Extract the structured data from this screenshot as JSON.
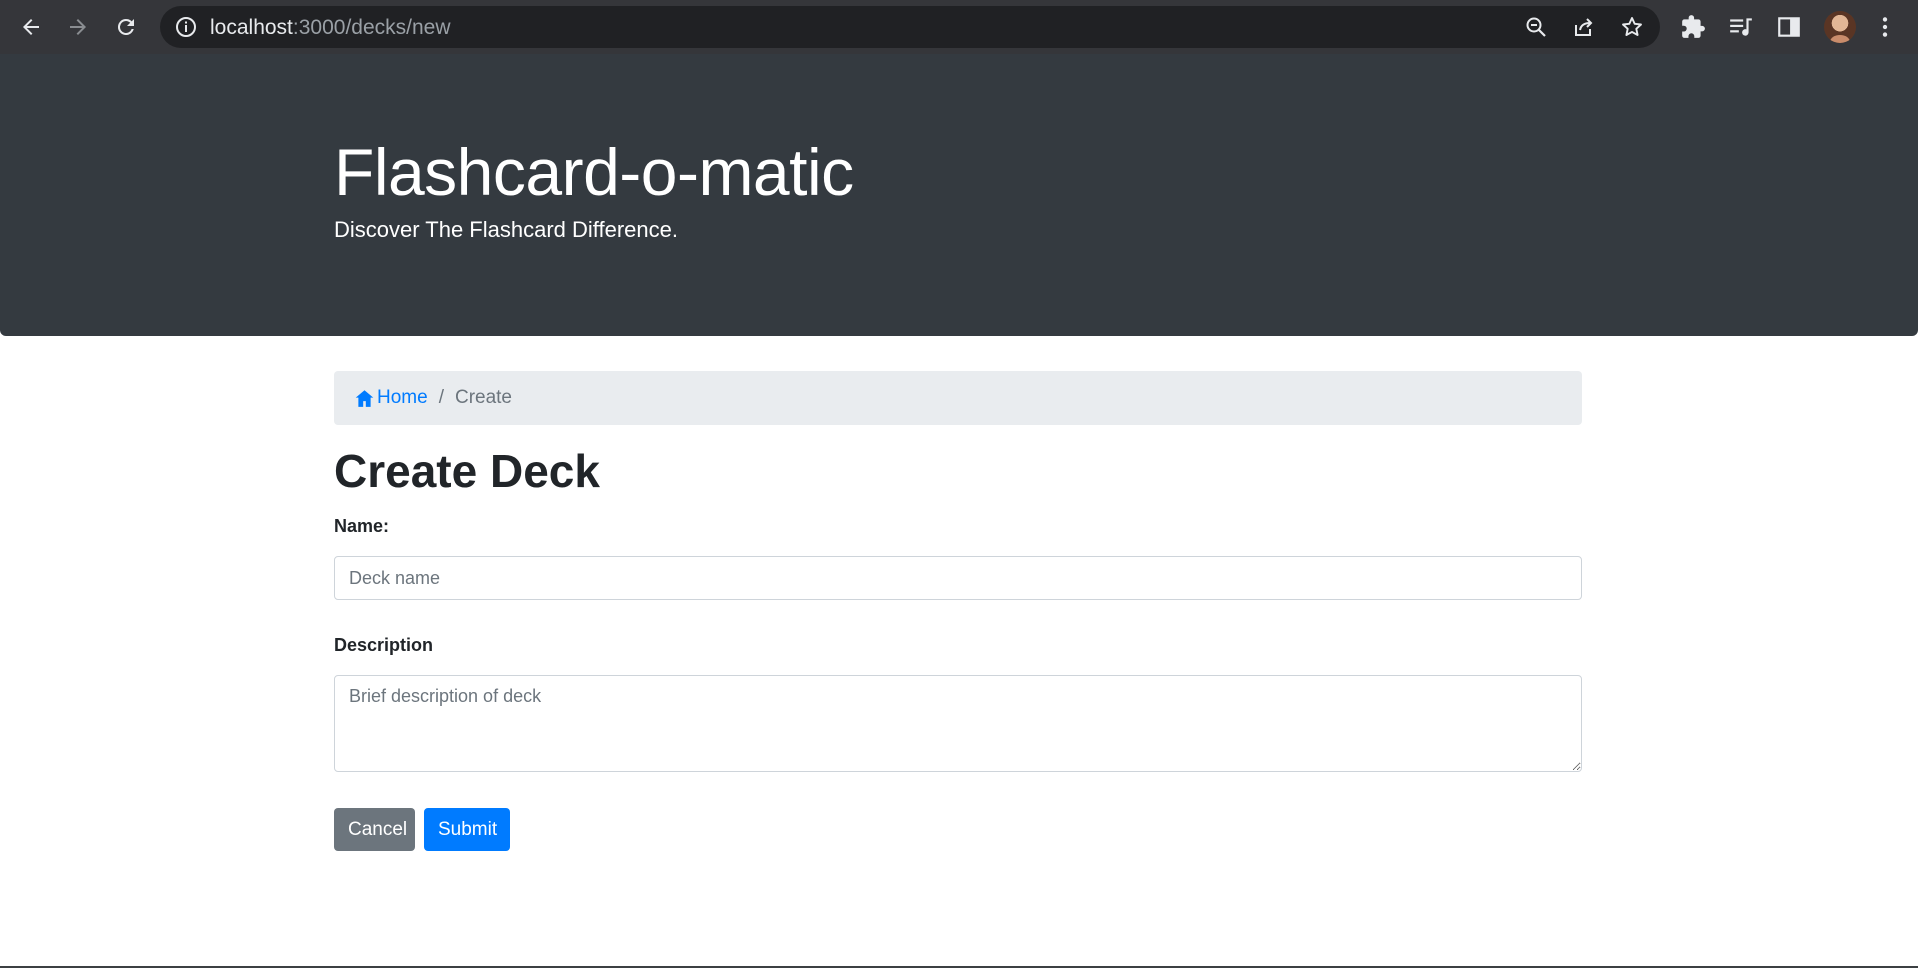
{
  "browser": {
    "url_host": "localhost",
    "url_path": ":3000/decks/new",
    "icons": {
      "back": "arrow-left-icon",
      "forward": "arrow-right-icon",
      "reload": "reload-icon",
      "site_info": "info-icon",
      "zoom": "zoom-out-icon",
      "share": "share-icon",
      "bookmark": "star-icon",
      "extensions": "puzzle-icon",
      "media": "media-queue-icon",
      "sidepanel": "side-panel-icon",
      "menu": "kebab-menu-icon"
    },
    "colors": {
      "chrome_bg": "#35363a",
      "omnibox_bg": "#202124"
    }
  },
  "header": {
    "title": "Flashcard-o-matic",
    "lead": "Discover The Flashcard Difference."
  },
  "breadcrumb": {
    "home_label": "Home",
    "separator": "/",
    "current": "Create"
  },
  "form": {
    "title": "Create Deck",
    "name_label": "Name:",
    "name_placeholder": "Deck name",
    "name_value": "",
    "description_label": "Description",
    "description_placeholder": "Brief description of deck",
    "description_value": "",
    "cancel_label": "Cancel",
    "submit_label": "Submit"
  },
  "colors": {
    "jumbotron_bg": "#343a40",
    "breadcrumb_bg": "#e9ecef",
    "primary": "#007bff",
    "secondary": "#6c757d",
    "text": "#212529"
  }
}
